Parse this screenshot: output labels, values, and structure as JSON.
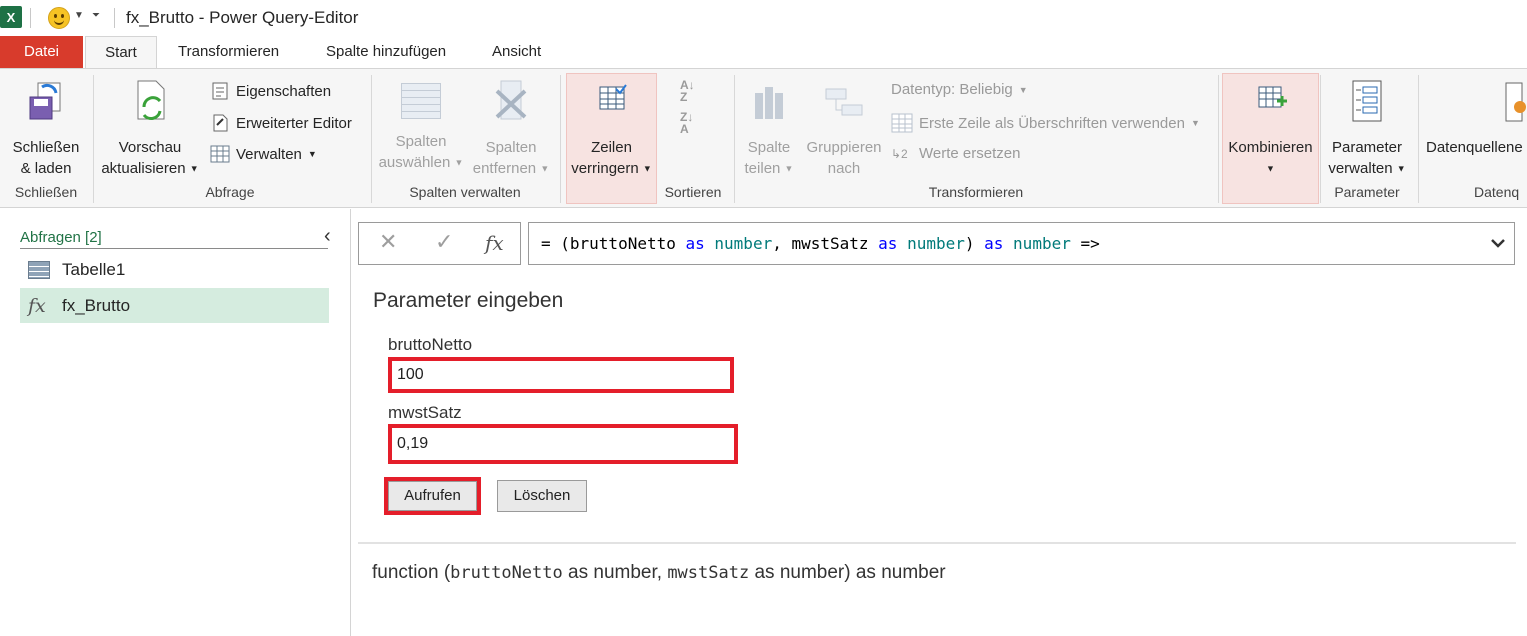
{
  "window": {
    "title": "fx_Brutto - Power Query-Editor",
    "app_icon_label": "X"
  },
  "tabs": [
    {
      "label": "Datei"
    },
    {
      "label": "Start"
    },
    {
      "label": "Transformieren"
    },
    {
      "label": "Spalte hinzufügen"
    },
    {
      "label": "Ansicht"
    }
  ],
  "ribbon": {
    "close_load": {
      "line1": "Schließen",
      "line2": "& laden",
      "group": "Schließen"
    },
    "query": {
      "preview_line1": "Vorschau",
      "preview_line2": "aktualisieren",
      "properties": "Eigenschaften",
      "advanced_editor": "Erweiterter Editor",
      "manage": "Verwalten",
      "group": "Abfrage"
    },
    "columns": {
      "choose_line1": "Spalten",
      "choose_line2": "auswählen",
      "remove_line1": "Spalten",
      "remove_line2": "entfernen",
      "group": "Spalten verwalten"
    },
    "reduce": {
      "line1": "Zeilen",
      "line2": "verringern"
    },
    "sort": {
      "group": "Sortieren"
    },
    "transform": {
      "split_line1": "Spalte",
      "split_line2": "teilen",
      "group_line1": "Gruppieren",
      "group_line2": "nach",
      "datatype": "Datentyp: Beliebig",
      "first_row": "Erste Zeile als Überschriften verwenden",
      "replace": "Werte ersetzen",
      "group": "Transformieren"
    },
    "combine": {
      "label": "Kombinieren"
    },
    "parameters": {
      "line1": "Parameter",
      "line2": "verwalten",
      "group": "Parameter"
    },
    "datasource": {
      "label": "Datenquellene",
      "group": "Datenq"
    }
  },
  "queries": {
    "header": "Abfragen [2]",
    "items": [
      {
        "label": "Tabelle1",
        "icon": "table-icon",
        "selected": false
      },
      {
        "label": "fx_Brutto",
        "icon": "fx-icon",
        "selected": true
      }
    ]
  },
  "formula_bar": {
    "fx_label": "fx",
    "parts": [
      "= (bruttoNetto ",
      "as",
      " ",
      "number",
      ", mwstSatz ",
      "as",
      " ",
      "number",
      ") ",
      "as",
      " ",
      "number",
      " =>"
    ]
  },
  "parameters_form": {
    "title": "Parameter eingeben",
    "fields": [
      {
        "label": "bruttoNetto",
        "value": "100"
      },
      {
        "label": "mwstSatz",
        "value": "0,19"
      }
    ],
    "invoke_label": "Aufrufen",
    "clear_label": "Löschen"
  },
  "signature": {
    "prefix": "function (",
    "p1": "bruttoNetto",
    "mid1": " as number, ",
    "p2": "mwstSatz",
    "suffix": " as number) as number"
  },
  "colors": {
    "accent_file_tab": "#d83b2c",
    "highlight_border": "#e41e2a",
    "selected_query": "#d5ecdf",
    "keyword": "#0000ff",
    "type": "#007a7a"
  }
}
